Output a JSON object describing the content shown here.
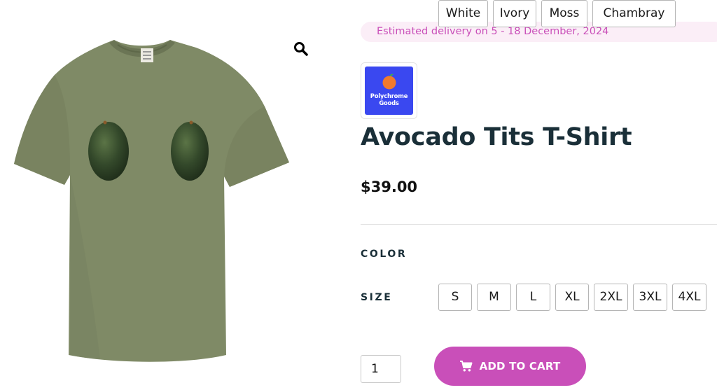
{
  "product": {
    "delivery_text": "Estimated delivery on 5 - 18 December, 2024",
    "brand_name": "Polychrome Goods",
    "title": "Avocado Tits T-Shirt",
    "price": "$39.00",
    "image_icon": "zoom-magnifier-icon"
  },
  "options": {
    "color_label": "COLOR",
    "colors": [
      "White",
      "Ivory",
      "Moss",
      "Chambray"
    ],
    "size_label": "SIZE",
    "sizes": [
      "S",
      "M",
      "L",
      "XL",
      "2XL",
      "3XL",
      "4XL"
    ]
  },
  "cart": {
    "quantity": "1",
    "add_label": "ADD TO CART",
    "icon": "cart-icon"
  },
  "colors": {
    "accent": "#c94fb9",
    "delivery_bg": "#fbeef7",
    "heading": "#1a2f38",
    "brand_bg": "#3a48f0",
    "shirt": "#7f8a66"
  }
}
